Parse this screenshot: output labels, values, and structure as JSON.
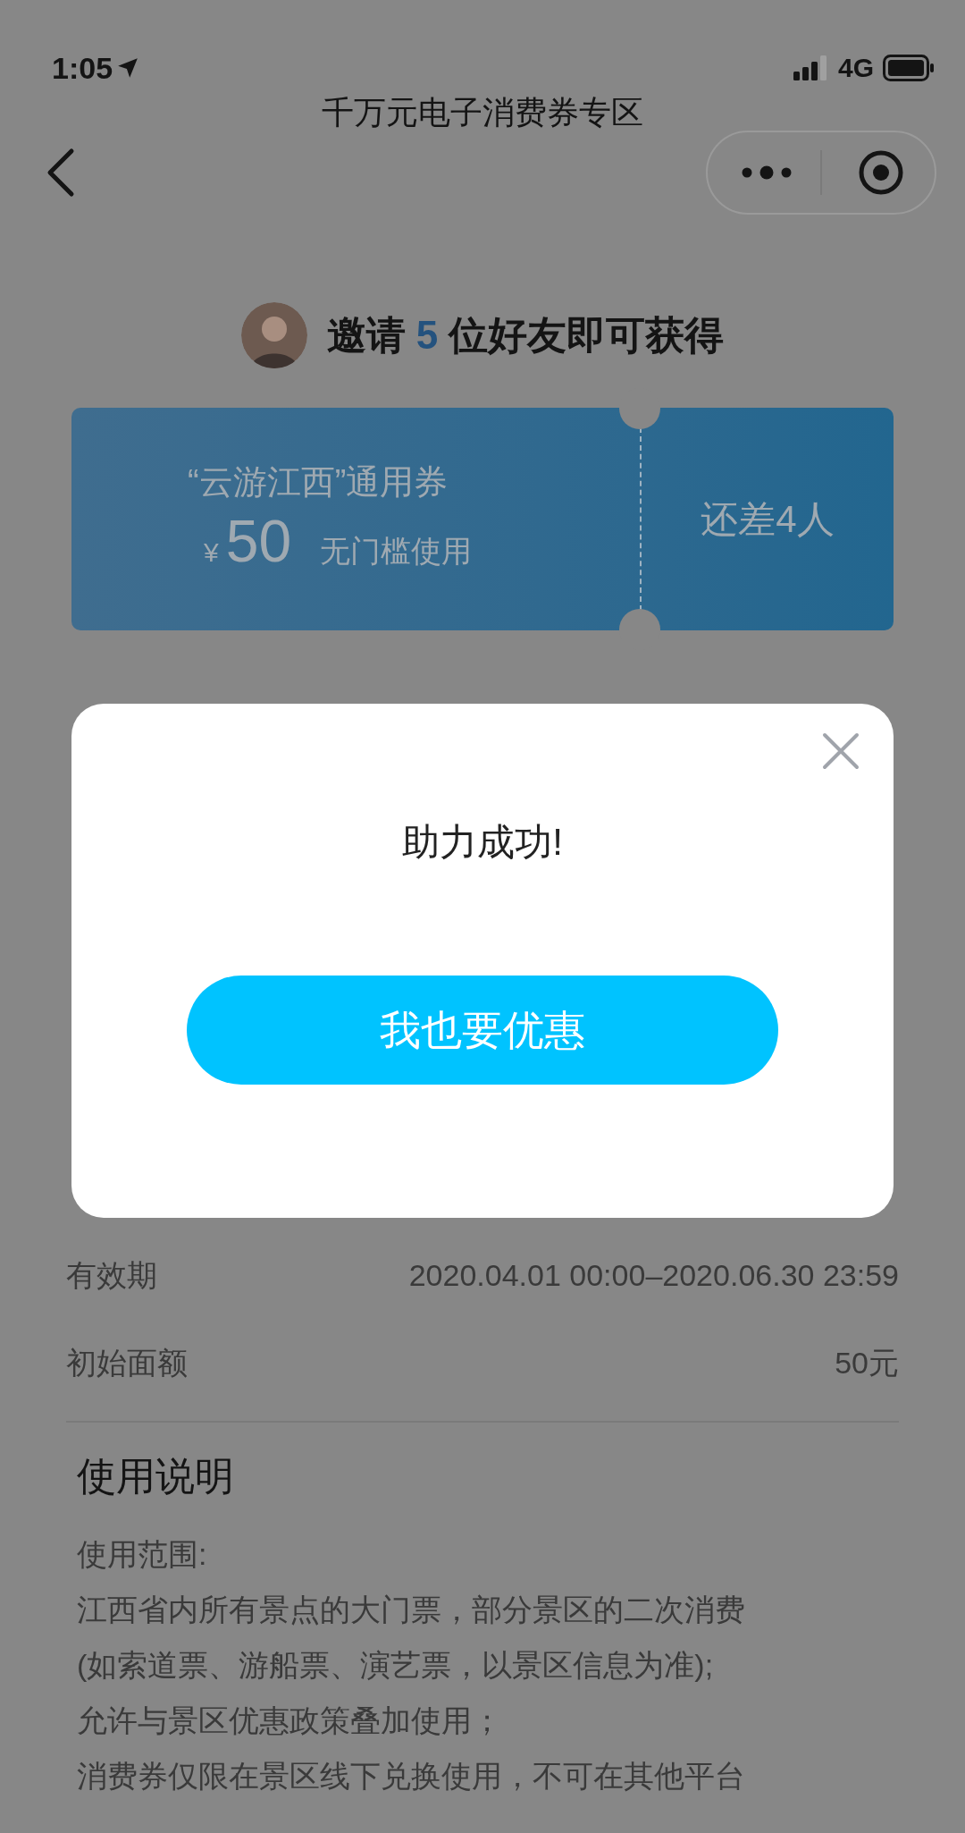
{
  "status_bar": {
    "time": "1:05",
    "network": "4G"
  },
  "nav": {
    "title": "千万元电子消费券专区"
  },
  "invite": {
    "prefix": "邀请",
    "count": "5",
    "suffix": "位好友即可获得"
  },
  "coupon": {
    "title": "“云游江西”通用券",
    "currency": "¥",
    "amount": "50",
    "condition": "无门槛使用",
    "status": "还差4人"
  },
  "modal": {
    "message": "助力成功!",
    "button": "我也要优惠"
  },
  "details": [
    {
      "label": "有效期",
      "value": "2020.04.01 00:00–2020.06.30 23:59"
    },
    {
      "label": "初始面额",
      "value": "50元"
    }
  ],
  "instructions": {
    "title": "使用说明",
    "lines": [
      "使用范围:",
      "江西省内所有景点的大门票，部分景区的二次消费",
      "(如索道票、游船票、演艺票，以景区信息为准);",
      "允许与景区优惠政策叠加使用；",
      "消费券仅限在景区线下兑换使用，不可在其他平台"
    ]
  }
}
